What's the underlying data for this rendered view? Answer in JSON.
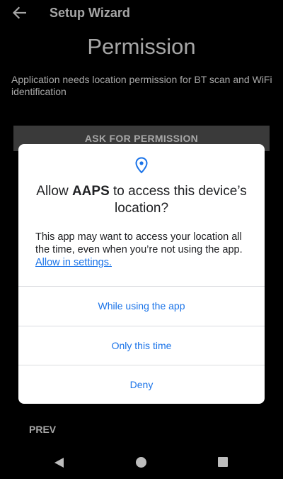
{
  "toolbar": {
    "title": "Setup Wizard",
    "back_icon": "arrow-back-icon"
  },
  "page": {
    "title": "Permission",
    "description": "Application needs location permission for BT scan and WiFi identification",
    "ask_button_label": "ASK FOR PERMISSION",
    "prev_label": "PREV"
  },
  "dialog": {
    "icon": "location-pin-icon",
    "title_prefix": "Allow ",
    "app_name": "AAPS",
    "title_suffix": " to access this device’s location?",
    "body_text": "This app may want to access your location all the time, even when you’re not using the app. ",
    "body_link": "Allow in settings.",
    "options": [
      "While using the app",
      "Only this time",
      "Deny"
    ]
  },
  "navbar": {
    "back_icon": "nav-back-icon",
    "home_icon": "nav-home-icon",
    "recents_icon": "nav-recents-icon"
  },
  "colors": {
    "accent": "#1a73e8",
    "button_bg": "#5a5a5a",
    "background": "#000000"
  }
}
